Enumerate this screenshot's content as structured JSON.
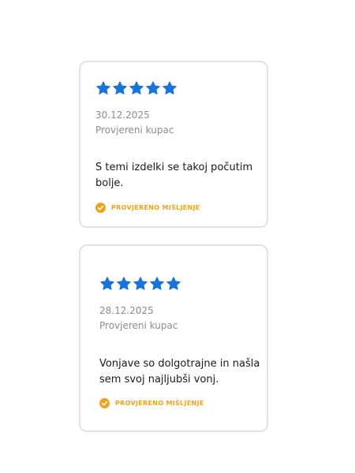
{
  "colors": {
    "star": "#1a73d9",
    "verified": "#f0a41c",
    "meta_text": "#8c8c8c",
    "body_text": "#1a1a1a",
    "card_border": "#e2e2e2"
  },
  "reviews": [
    {
      "rating": 5,
      "max_rating": 5,
      "date": "30.12.2025",
      "buyer": "Provjereni kupac",
      "text": "S temi izdelki se takoj počutim bolje.",
      "verified_label": "PROVJERENO MIŠLJENJE",
      "verified_icon": "check-circle-icon",
      "star_icon": "star-icon"
    },
    {
      "rating": 5,
      "max_rating": 5,
      "date": "28.12.2025",
      "buyer": "Provjereni kupac",
      "text": "Vonjave so dolgotrajne in našla sem svoj najljubši vonj.",
      "verified_label": "PROVJERENO MIŠLJENJE",
      "verified_icon": "check-circle-icon",
      "star_icon": "star-icon"
    }
  ]
}
